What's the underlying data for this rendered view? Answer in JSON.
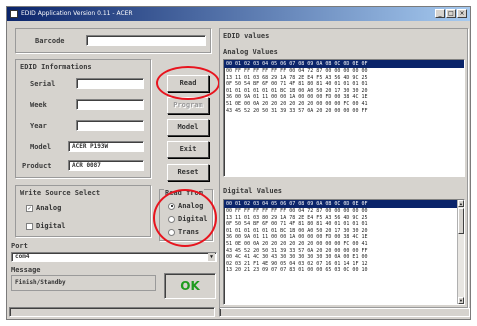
{
  "window": {
    "title": "EDID Application Version 0.11 - ACER",
    "ctrl_min": "_",
    "ctrl_max": "□",
    "ctrl_close": "×"
  },
  "barcode": {
    "label": "Barcode",
    "value": ""
  },
  "edid_info": {
    "title": "EDID Informations",
    "serial_label": "Serial",
    "serial_value": "",
    "week_label": "Week",
    "week_value": "",
    "year_label": "Year",
    "year_value": "",
    "model_label": "Model",
    "model_value": "ACER P193W",
    "product_label": "Product",
    "product_value": "ACR 0087"
  },
  "buttons": {
    "read": "Read",
    "program": "Program",
    "model": "Model",
    "exit": "Exit",
    "reset": "Reset"
  },
  "write_source": {
    "title": "Write Source Select",
    "analog": "Analog",
    "analog_checked": true,
    "digital": "Digital",
    "digital_checked": false
  },
  "read_from": {
    "title": "Read from",
    "analog": "Analog",
    "digital": "Digital",
    "trans": "Trans",
    "selected": "analog"
  },
  "port": {
    "label": "Port",
    "value": "com4"
  },
  "message": {
    "label": "Message",
    "value": "Finish/Standby"
  },
  "status": {
    "value": "OK",
    "color": "#1e9b1e"
  },
  "edid_values": {
    "title": "EDID values",
    "analog_title": "Analog Values",
    "analog_header": "00 01 02 03 04 05 06 07 08 09 0A 0B 0C 0D 0E 0F",
    "analog_rows": [
      "00 FF FF FF FF FF FF 00 04 72 87 00 00 00 00 00",
      "13 11 01 03 68 29 1A 78 2E E4 F5 A3 56 4D 9C 25",
      "0F 50 54 BF 6F 00 71 4F 81 80 81 40 01 01 01 01",
      "01 01 01 01 01 01 BC 1B 00 A0 50 20 17 30 30 20",
      "36 00 9A 01 11 00 00 1A 00 00 00 FD 00 38 4C 1E",
      "51 0E 00 0A 20 20 20 20 20 20 00 00 00 FC 00 41",
      "43 45 52 20 50 31 39 33 57 0A 20 20 00 00 00 FF"
    ],
    "digital_title": "Digital Values",
    "digital_header": "00 01 02 03 04 05 06 07 08 09 0A 0B 0C 0D 0E 0F",
    "digital_rows": [
      "00 FF FF FF FF FF FF 00 04 72 87 00 00 00 00 00",
      "13 11 01 03 80 29 1A 78 2E E4 F5 A3 56 4D 9C 25",
      "0F 50 54 BF 6F 00 71 4F 81 80 81 40 01 01 01 01",
      "01 01 01 01 01 01 BC 1B 00 A0 50 20 17 30 30 20",
      "36 00 9A 01 11 00 00 1A 00 00 00 FD 00 38 4C 1E",
      "51 0E 00 0A 20 20 20 20 20 20 00 00 00 FC 00 41",
      "43 45 52 20 50 31 39 33 57 0A 20 20 00 00 00 FF",
      "00 4C 41 4C 30 43 30 30 30 30 30 30 0A 00 E1 00",
      "02 03 21 F1 4E 90 05 04 03 02 07 16 01 14 1F 12",
      "13 20 21 23 09 07 07 83 01 00 00 65 03 0C 00 10"
    ]
  }
}
